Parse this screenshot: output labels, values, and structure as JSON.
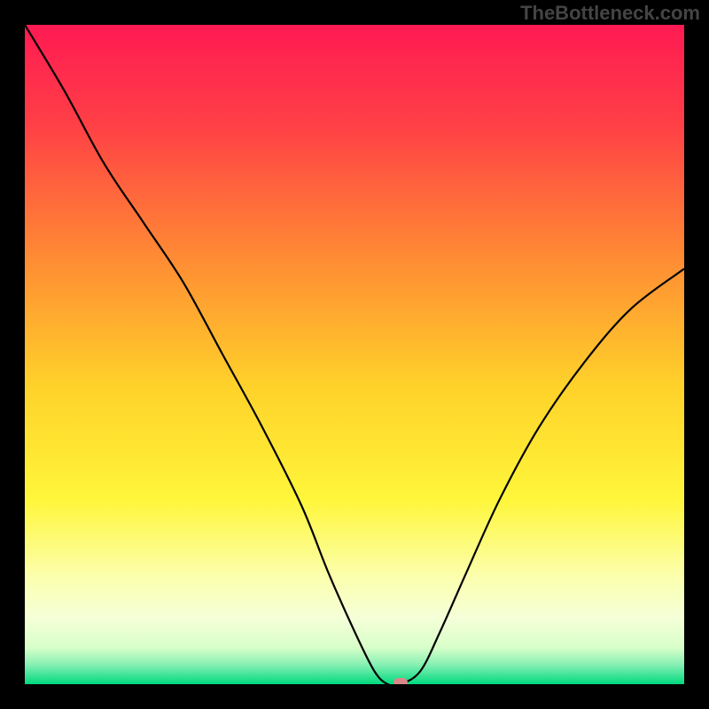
{
  "watermark": "TheBottleneck.com",
  "colors": {
    "frame": "#000000",
    "watermark_text": "#444444",
    "curve": "#000000",
    "marker": "#d98888",
    "gradient_stops": [
      {
        "offset": 0.0,
        "color": "#ff1a53"
      },
      {
        "offset": 0.15,
        "color": "#ff3f46"
      },
      {
        "offset": 0.35,
        "color": "#ff8a34"
      },
      {
        "offset": 0.55,
        "color": "#ffd22a"
      },
      {
        "offset": 0.72,
        "color": "#fff63a"
      },
      {
        "offset": 0.84,
        "color": "#fbffb0"
      },
      {
        "offset": 0.9,
        "color": "#f5ffd8"
      },
      {
        "offset": 0.945,
        "color": "#d7ffc8"
      },
      {
        "offset": 0.97,
        "color": "#88f0b4"
      },
      {
        "offset": 1.0,
        "color": "#00d97e"
      }
    ]
  },
  "chart_data": {
    "type": "line",
    "title": "",
    "xlabel": "",
    "ylabel": "",
    "xlim": [
      0,
      100
    ],
    "ylim": [
      0,
      100
    ],
    "x": [
      0,
      6,
      12,
      18,
      24,
      30,
      36,
      42,
      46,
      50,
      53,
      55,
      57,
      60,
      63,
      67,
      72,
      78,
      85,
      92,
      100
    ],
    "values": [
      100,
      90,
      79,
      70,
      61,
      50,
      39,
      27,
      17,
      8,
      2,
      0,
      0,
      2,
      8,
      17,
      28,
      39,
      49,
      57,
      63
    ],
    "annotations": [
      {
        "type": "marker",
        "x": 57,
        "y": 0,
        "label": "optimal-point"
      }
    ]
  }
}
